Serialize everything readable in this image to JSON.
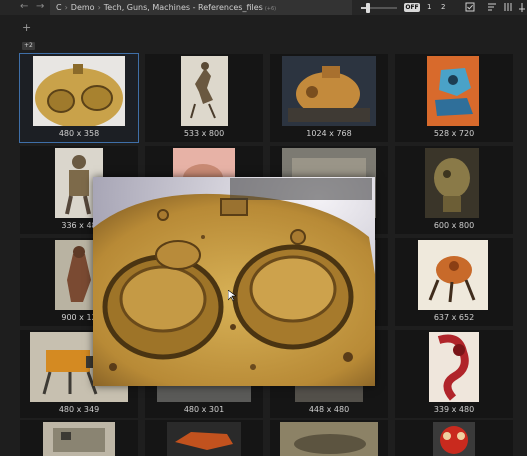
{
  "toolbar": {
    "back_icon": "arrow-left-icon",
    "forward_icon": "arrow-right-icon",
    "path": [
      "C",
      "Demo",
      "Tech, Guns, Machines - References_files"
    ],
    "path_badge": "(+6)",
    "zoom_slider_level": 0.2,
    "toggle_label": "OFF",
    "pages": [
      "1",
      "2"
    ],
    "icons": [
      "checkbox-icon",
      "sort-icon",
      "columns-icon",
      "pin-icon"
    ]
  },
  "left_rail": {
    "add_label": "+",
    "count_badge": "+2"
  },
  "grid": {
    "items": [
      {
        "label": "480 x 358"
      },
      {
        "label": "533 x 800"
      },
      {
        "label": "1024 x 768"
      },
      {
        "label": "528 x 720"
      },
      {
        "label": "336 x 48"
      },
      {
        "label": ""
      },
      {
        "label": ""
      },
      {
        "label": "600 x 800"
      },
      {
        "label": "900 x 12"
      },
      {
        "label": ""
      },
      {
        "label": ""
      },
      {
        "label": "637 x 652"
      },
      {
        "label": "480 x 349"
      },
      {
        "label": "480 x 301"
      },
      {
        "label": "448 x 480"
      },
      {
        "label": "339 x 480"
      },
      {
        "label": ""
      },
      {
        "label": ""
      },
      {
        "label": ""
      },
      {
        "label": ""
      }
    ]
  },
  "preview": {
    "subject": "rusty yellow tank turret close-up"
  },
  "colors": {
    "background": "#1e1e1e",
    "cell": "#151515",
    "selected_outline": "#3f6fa8",
    "breadcrumb_bg": "#333333"
  }
}
